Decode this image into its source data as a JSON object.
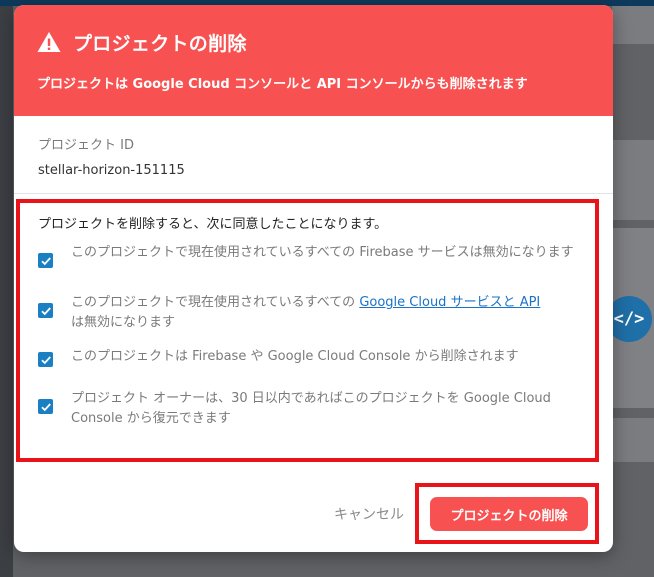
{
  "dialog": {
    "title": "プロジェクトの削除",
    "subtitle": "プロジェクトは Google Cloud コンソールと API コンソールからも削除されます",
    "project_id_label": "プロジェクト ID",
    "project_id_value": "stellar-horizon-151115",
    "consent_intro": "プロジェクトを削除すると、次に同意したことになります。",
    "consent_items": [
      {
        "text": "このプロジェクトで現在使用されているすべての Firebase サービスは無効になります",
        "checked": true
      },
      {
        "text_before": "このプロジェクトで現在使用されているすべての ",
        "link": "Google Cloud サービスと API",
        "text_after": "は無効になります",
        "checked": true
      },
      {
        "text": "このプロジェクトは Firebase や Google Cloud Console から削除されます",
        "checked": true
      },
      {
        "text": "プロジェクト オーナーは、30 日以内であればこのプロジェクトを Google Cloud Console から復元できます",
        "checked": true
      }
    ],
    "cancel_label": "キャンセル",
    "delete_label": "プロジェクトの削除"
  },
  "background": {
    "code_button_label": "</>"
  },
  "colors": {
    "header_bg": "#f75251",
    "highlight_border": "#e8141a",
    "checkbox": "#1b7fc4",
    "link": "#1a73c7"
  }
}
